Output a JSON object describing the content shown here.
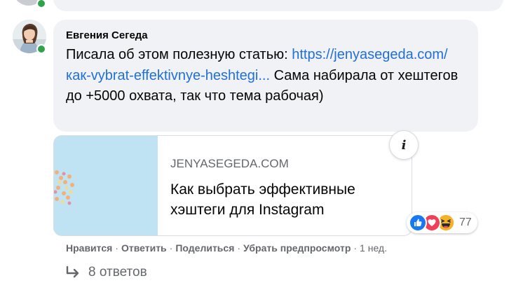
{
  "comment": {
    "author": "Евгения Сегеда",
    "text_before": "Писала об этом полезную статью: ",
    "link_text": "https://jenyasegeda.com/как-vybrat-effektivnye-heshtegi...",
    "text_after": " Сама набирала от хештегов до +5000 охвата, так что тема рабочая)"
  },
  "preview": {
    "domain": "JENYASEGEDA.COM",
    "title": "Как выбрать эффективные хэштеги для Instagram",
    "info_label": "i"
  },
  "reactions": {
    "icons": [
      "like-icon",
      "love-icon",
      "haha-icon"
    ],
    "count": "77"
  },
  "actions": {
    "like": "Нравится",
    "reply": "Ответить",
    "share": "Поделиться",
    "remove_preview": "Убрать предпросмотр",
    "separator": "·",
    "time": "1 нед."
  },
  "replies": {
    "label": "8 ответов"
  },
  "colors": {
    "link": "#216fdb",
    "bubble_bg": "#f0f2f5",
    "secondary_text": "#65676b",
    "online": "#31a24c",
    "like": "#1877f2",
    "love": "#f33e58",
    "haha": "#f7b125"
  }
}
